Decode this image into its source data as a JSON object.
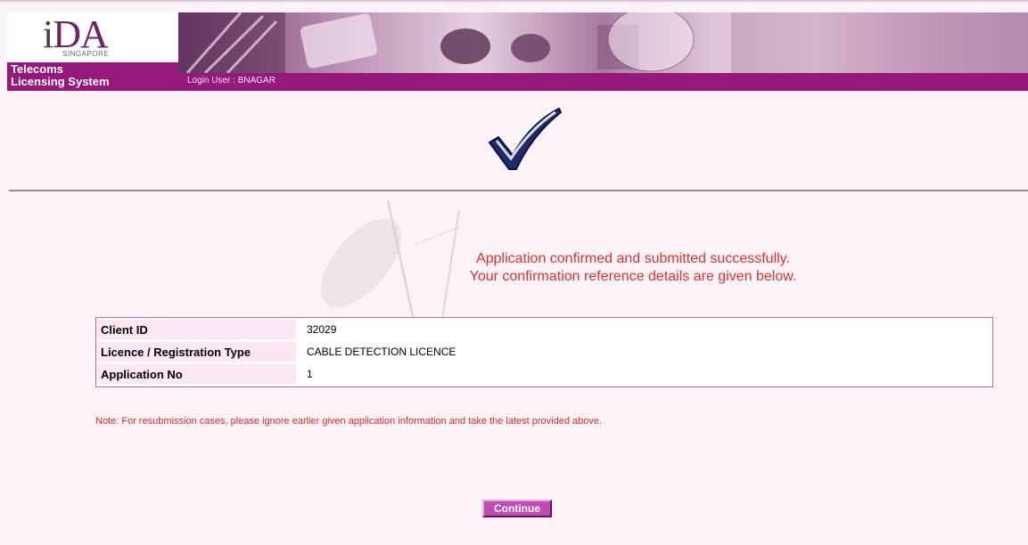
{
  "header": {
    "logo_main": "DA",
    "logo_i": "i",
    "logo_sub": "SINGAPORE",
    "system_title_line1": "Telecoms",
    "system_title_line2": "Licensing System",
    "login_user": "Login User : BNAGAR"
  },
  "confirmation": {
    "line1": "Application confirmed and submitted successfully.",
    "line2": "Your confirmation reference details are given below."
  },
  "details": {
    "rows": [
      {
        "label": "Client ID",
        "value": "32029"
      },
      {
        "label": "Licence / Registration Type",
        "value": "CABLE DETECTION LICENCE"
      },
      {
        "label": "Application No",
        "value": "1"
      }
    ]
  },
  "note": "Note: For resubmission cases, please ignore earlier given application information and take the latest provided above.",
  "buttons": {
    "continue_label": "Continue"
  },
  "colors": {
    "brand_purple": "#95197a",
    "message_red": "#e0302e",
    "button_purple": "#bf4bb3"
  }
}
